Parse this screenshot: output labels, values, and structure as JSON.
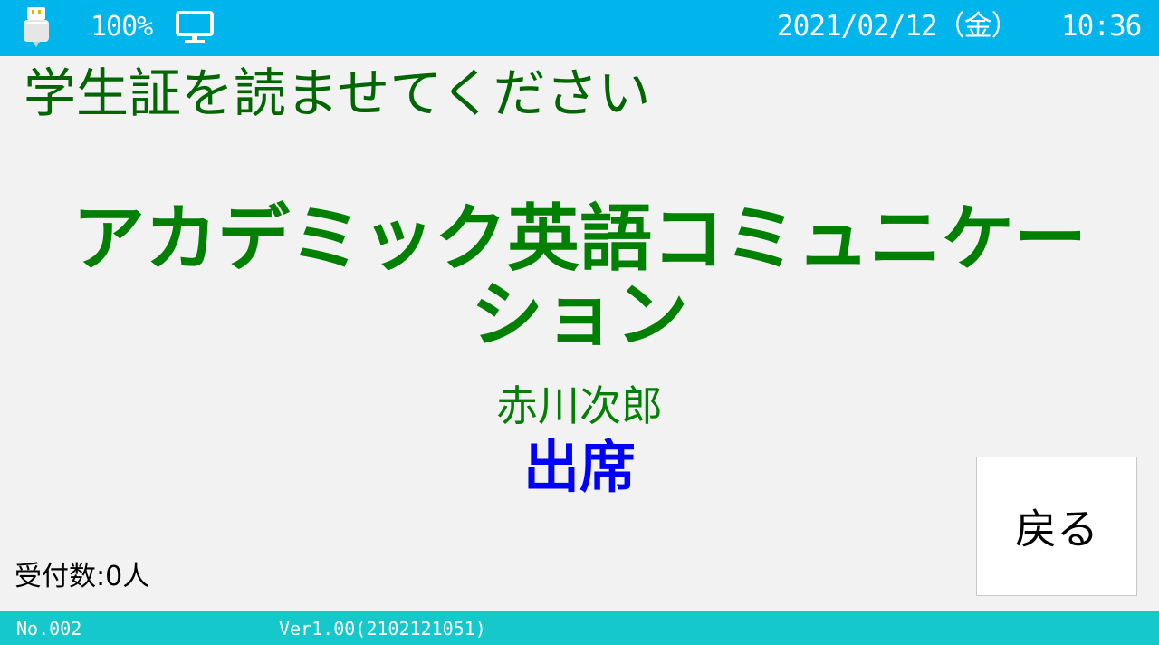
{
  "status_bar": {
    "usb_icon": "usb-drive-icon",
    "battery": "100%",
    "monitor_icon": "monitor-icon",
    "date": "2021/02/12（金）",
    "time": "10:36"
  },
  "main": {
    "instruction": "学生証を読ませてください",
    "course_name_line1": "アカデミック英語コミュニケー",
    "course_name_line2": "ション",
    "student_name": "赤川次郎",
    "attendance_status": "出席",
    "reception_count": "受付数:0人",
    "back_button_label": "戻る"
  },
  "footer": {
    "device_no": "No.002",
    "version": "Ver1.00(2102121051)"
  },
  "colors": {
    "top_bar": "#00b4ec",
    "bottom_bar": "#14c8cc",
    "instruction_text": "#006600",
    "course_text": "#008000",
    "status_text": "#0000ff"
  }
}
